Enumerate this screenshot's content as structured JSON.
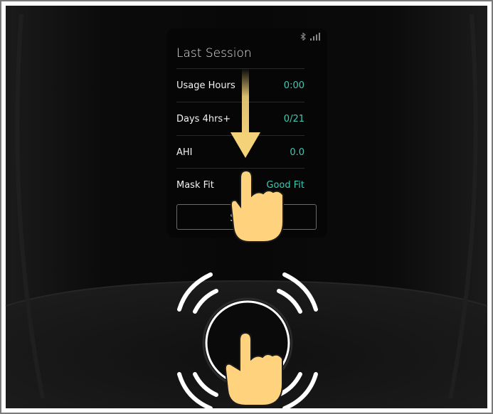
{
  "screen": {
    "title": "Last Session",
    "status_icons": [
      "bluetooth-icon",
      "signal-bars-icon"
    ],
    "rows": [
      {
        "label": "Usage Hours",
        "value": "0:00"
      },
      {
        "label": "Days 4hrs+",
        "value": "0/21"
      },
      {
        "label": "AHI",
        "value": "0.0"
      },
      {
        "label": "Mask Fit",
        "value": "Good Fit"
      }
    ],
    "button_label": "Setup"
  },
  "overlay": {
    "gesture": "swipe-down",
    "icons": [
      "down-arrow-icon",
      "pointing-hand-icon",
      "tap-waves-icon"
    ]
  },
  "colors": {
    "accent_value": "#3fc9b2",
    "screen_bg": "#060606",
    "device_body": "#121212",
    "highlight_arrow": "#f4d27a",
    "hand_fill": "#ffd27e"
  }
}
